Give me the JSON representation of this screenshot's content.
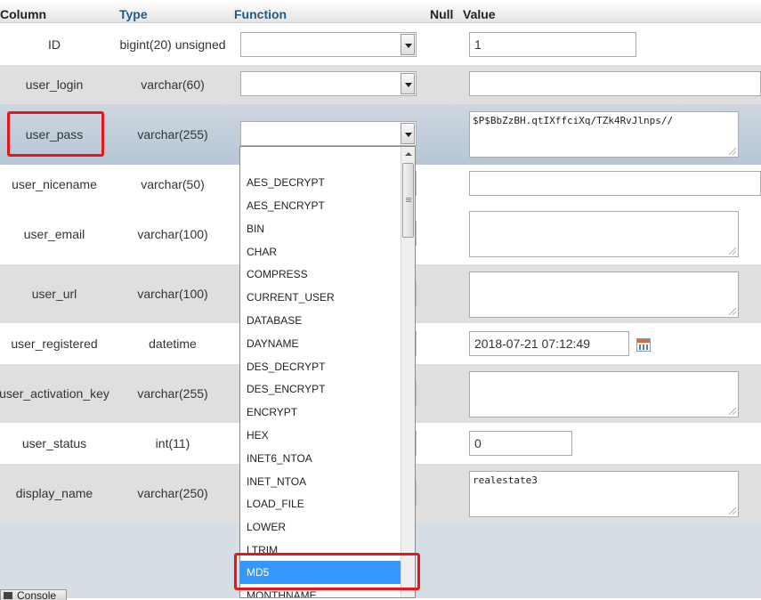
{
  "header": {
    "column": "Column",
    "type": "Type",
    "function": "Function",
    "null": "Null",
    "value": "Value"
  },
  "rows": [
    {
      "column": "ID",
      "type": "bigint(20) unsigned",
      "value": "1"
    },
    {
      "column": "user_login",
      "type": "varchar(60)",
      "value": ""
    },
    {
      "column": "user_pass",
      "type": "varchar(255)",
      "value": "$P$BbZzBH.qtIXffciXq/TZk4RvJlnps//"
    },
    {
      "column": "user_nicename",
      "type": "varchar(50)",
      "value": ""
    },
    {
      "column": "user_email",
      "type": "varchar(100)",
      "value": ""
    },
    {
      "column": "user_url",
      "type": "varchar(100)",
      "value": ""
    },
    {
      "column": "user_registered",
      "type": "datetime",
      "value": "2018-07-21 07:12:49"
    },
    {
      "column": "user_activation_key",
      "type": "varchar(255)",
      "value": ""
    },
    {
      "column": "user_status",
      "type": "int(11)",
      "value": "0"
    },
    {
      "column": "display_name",
      "type": "varchar(250)",
      "value": "realestate3"
    }
  ],
  "function_options": [
    "AES_DECRYPT",
    "AES_ENCRYPT",
    "BIN",
    "CHAR",
    "COMPRESS",
    "CURRENT_USER",
    "DATABASE",
    "DAYNAME",
    "DES_DECRYPT",
    "DES_ENCRYPT",
    "ENCRYPT",
    "HEX",
    "INET6_NTOA",
    "INET_NTOA",
    "LOAD_FILE",
    "LOWER",
    "LTRIM",
    "MD5",
    "MONTHNAME"
  ],
  "selected_function": "MD5",
  "console": {
    "label": "Console"
  },
  "colors": {
    "highlight": "#3399ff",
    "annotation": "#e8161a",
    "header_link": "#235a81"
  }
}
